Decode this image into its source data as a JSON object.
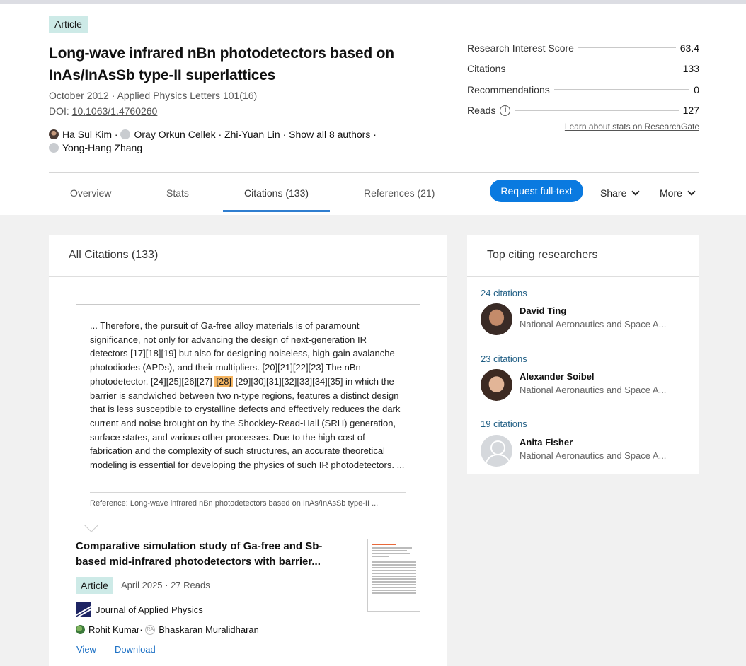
{
  "header": {
    "badge": "Article",
    "title": "Long-wave infrared nBn photodetectors based on InAs/InAsSb type-II superlattices",
    "date_prefix": "October 2012 · ",
    "journal": "Applied Physics Letters",
    "volume": " 101(16)",
    "doi_label": "DOI: ",
    "doi": "10.1063/1.4760260",
    "authors": {
      "a1": "Ha Sul Kim",
      "sep1": " · ",
      "a2": "Oray Orkun Cellek",
      "sep2": " · ",
      "a3": "Zhi-Yuan Lin",
      "sep3": " · ",
      "show_all": "Show all 8 authors",
      "sep4": " ·",
      "a4": "Yong-Hang Zhang"
    }
  },
  "stats": {
    "research_interest_label": "Research Interest Score",
    "research_interest_value": "63.4",
    "citations_label": "Citations",
    "citations_value": "133",
    "recommendations_label": "Recommendations",
    "recommendations_value": "0",
    "reads_label": "Reads",
    "reads_value": "127",
    "learn_more": "Learn about stats on ResearchGate"
  },
  "tabs": {
    "overview": "Overview",
    "stats": "Stats",
    "citations": "Citations (133)",
    "references": "References (21)"
  },
  "actions": {
    "request": "Request full-text",
    "share": "Share",
    "more": "More"
  },
  "citations_card": {
    "heading": "All Citations (133)",
    "quote_before": "... Therefore, the pursuit of Ga-free alloy materials is of paramount significance, not only for advancing the design of next-generation IR detectors [17][18][19] but also for designing noiseless, high-gain avalanche photodiodes (APDs), and their multipliers. [20][21][22][23] The nBn photodetector, [24][25][26][27] ",
    "quote_highlight": "[28]",
    "quote_after": " [29][30][31][32][33][34][35] in which the barrier is sandwiched between two n-type regions, features a distinct design that is less susceptible to crystalline defects and effectively reduces the dark current and noise brought on by the Shockley-Read-Hall (SRH) generation, surface states, and various other processes. Due to the high cost of fabrication and the complexity of such structures, an accurate theoretical modeling is essential for developing the physics of such IR photodetectors. ...",
    "reference": "Reference: Long-wave infrared nBn photodetectors based on InAs/InAsSb type-II ...",
    "item": {
      "title": "Comparative simulation study of Ga-free and Sb-based mid-infrared photodetectors with barrier...",
      "badge": "Article",
      "meta": "April 2025 · 27 Reads",
      "journal": "Journal of Applied Physics",
      "author1": "Rohit Kumar",
      "sep": " · ",
      "author2": "Bhaskaran Muralidharan",
      "view": "View",
      "download": "Download"
    }
  },
  "top_citing": {
    "heading": "Top citing researchers",
    "researchers": [
      {
        "count": "24 citations",
        "name": "David Ting",
        "institution": "National Aeronautics and Space A..."
      },
      {
        "count": "23 citations",
        "name": "Alexander Soibel",
        "institution": "National Aeronautics and Space A..."
      },
      {
        "count": "19 citations",
        "name": "Anita Fisher",
        "institution": "National Aeronautics and Space A..."
      }
    ]
  }
}
